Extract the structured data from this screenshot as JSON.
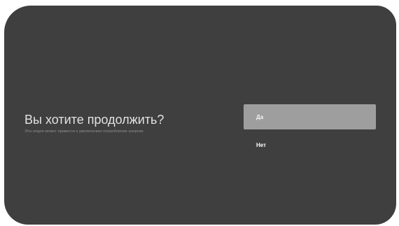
{
  "dialog": {
    "title": "Вы хотите продолжить?",
    "subtitle": "Эта опция может привести к увеличению потребления энергии.",
    "options": [
      {
        "label": "Да",
        "selected": true
      },
      {
        "label": "Нет",
        "selected": false
      }
    ]
  },
  "colors": {
    "background": "#3f3f3f",
    "selected_option": "#9e9e9e",
    "title_text": "#e2e2e2",
    "subtitle_text": "#8e8e8e"
  }
}
